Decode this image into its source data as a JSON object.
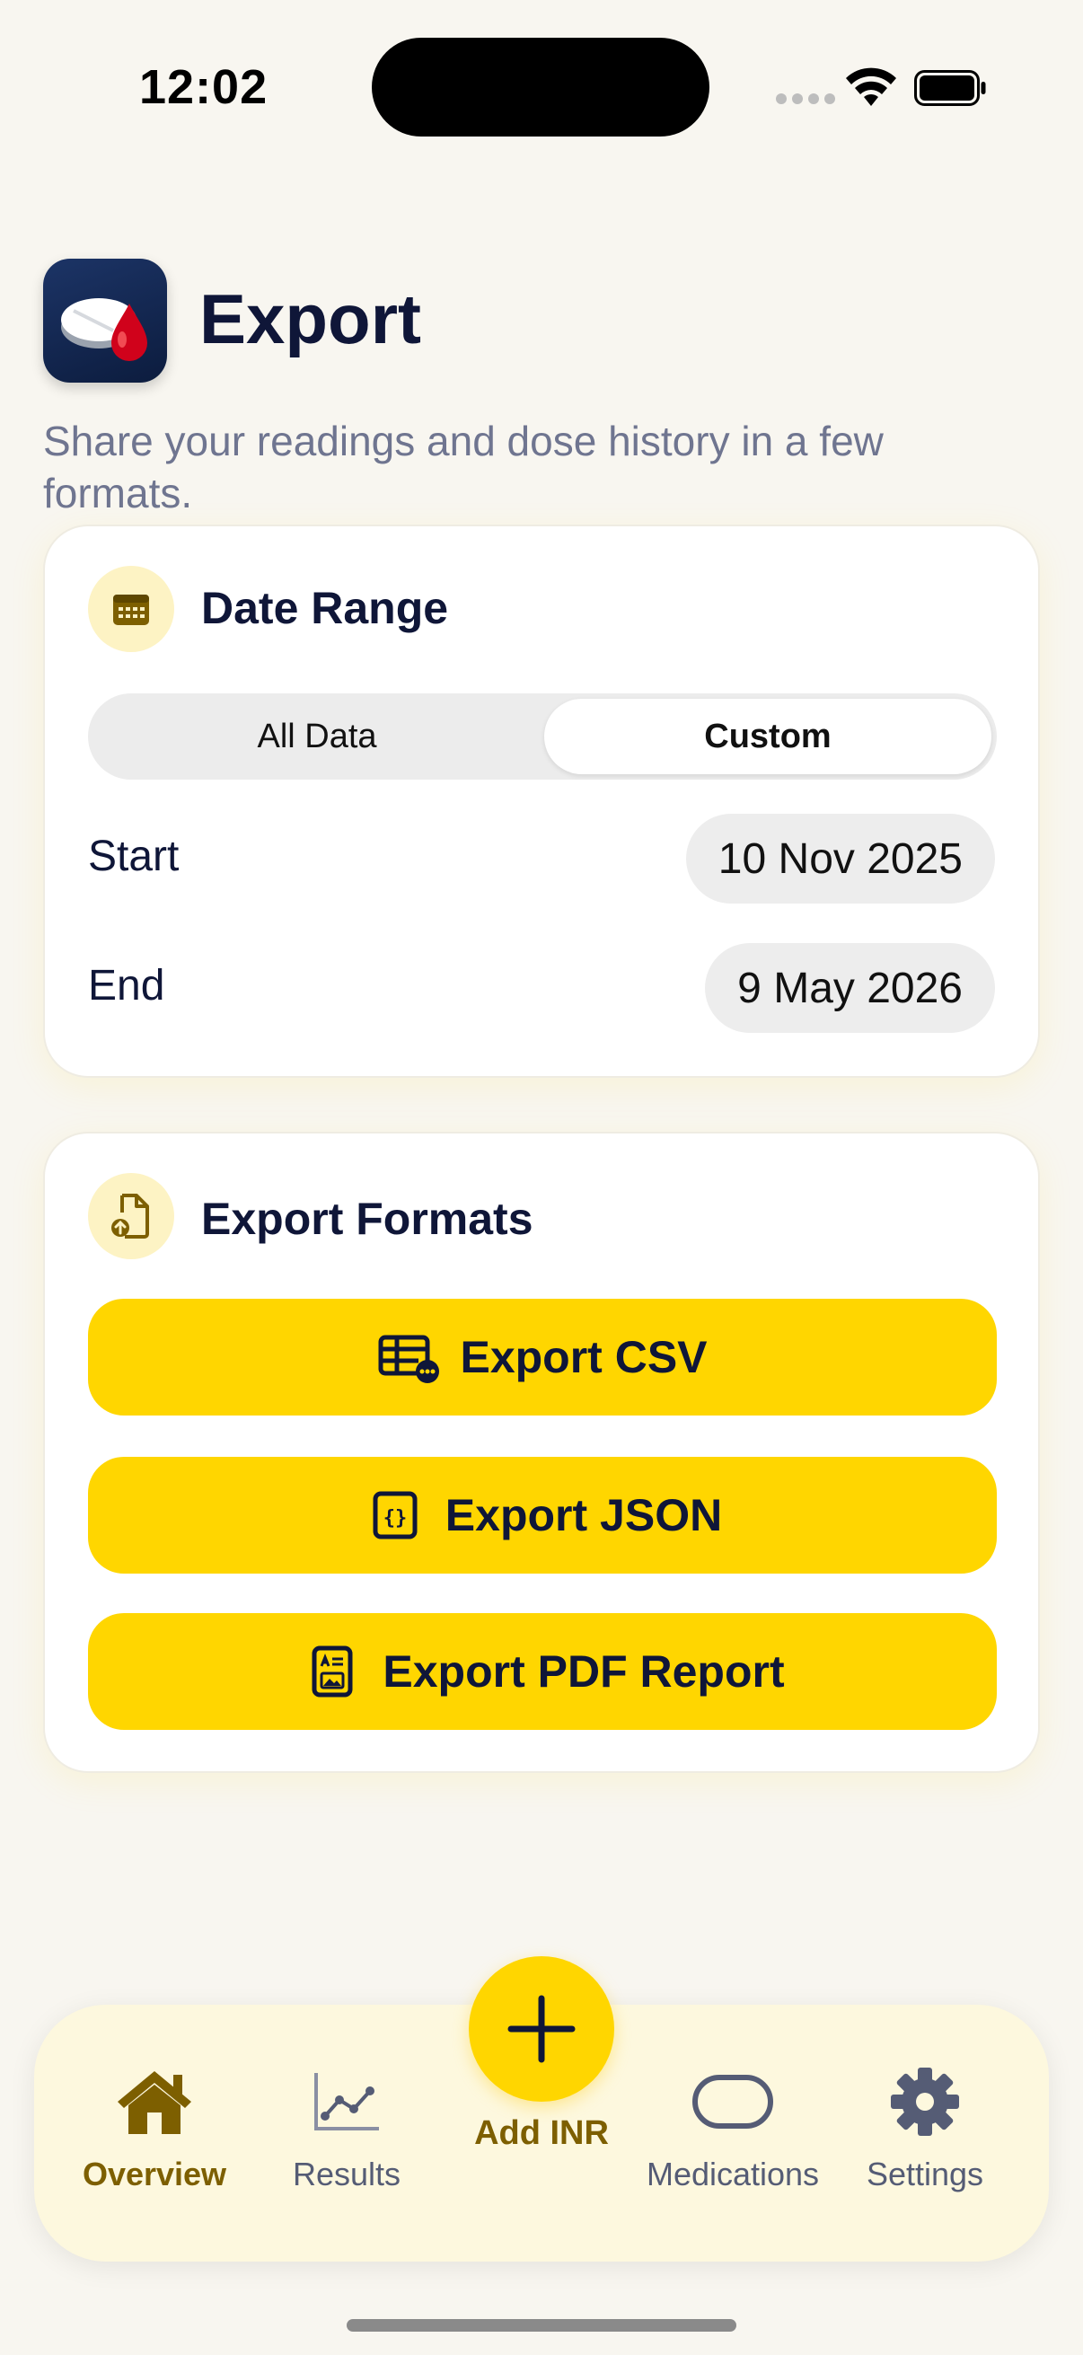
{
  "status_bar": {
    "time": "12:02"
  },
  "header": {
    "title": "Export",
    "subtitle": "Share your readings and dose history in a few formats."
  },
  "date_range": {
    "title": "Date Range",
    "segments": {
      "all": "All Data",
      "custom": "Custom",
      "selected": "Custom"
    },
    "start_label": "Start",
    "start_value": "10 Nov 2025",
    "end_label": "End",
    "end_value": "9 May 2026"
  },
  "export_formats": {
    "title": "Export Formats",
    "buttons": [
      {
        "label": "Export CSV",
        "icon": "table-icon"
      },
      {
        "label": "Export JSON",
        "icon": "braces-icon"
      },
      {
        "label": "Export PDF Report",
        "icon": "report-icon"
      }
    ]
  },
  "tab_bar": {
    "items": [
      {
        "label": "Overview",
        "icon": "home-icon",
        "active": true
      },
      {
        "label": "Results",
        "icon": "chart-line-icon",
        "active": false
      },
      {
        "label": "Add INR",
        "icon": "plus-icon",
        "active": false
      },
      {
        "label": "Medications",
        "icon": "pill-icon",
        "active": false
      },
      {
        "label": "Settings",
        "icon": "gear-icon",
        "active": false
      }
    ]
  },
  "colors": {
    "accent": "#FFD600",
    "background": "#F8F6F0",
    "text_primary": "#0F1638",
    "text_secondary": "#6F7590",
    "tab_active": "#7D5F00"
  }
}
